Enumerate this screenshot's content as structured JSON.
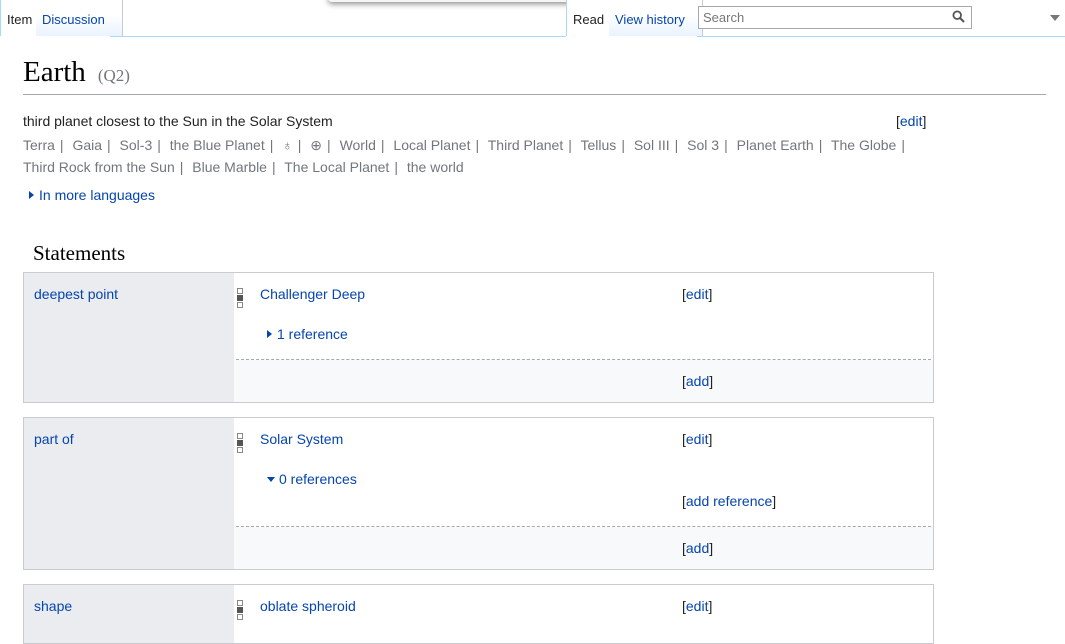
{
  "tabs": {
    "item": "Item",
    "discussion": "Discussion",
    "read": "Read",
    "view_history": "View history"
  },
  "search": {
    "placeholder": "Search"
  },
  "entity": {
    "label": "Earth",
    "id": "(Q2)",
    "description": "third planet closest to the Sun in the Solar System",
    "edit_label": "edit",
    "aliases": [
      "Terra",
      "Gaia",
      "Sol-3",
      "the Blue Planet",
      "♁",
      "⊕",
      "World",
      "Local Planet",
      "Third Planet",
      "Tellus",
      "Sol III",
      "Sol 3",
      "Planet Earth",
      "The Globe",
      "Third Rock from the Sun",
      "Blue Marble",
      "The Local Planet",
      "the world"
    ],
    "more_languages": "In more languages"
  },
  "statements": {
    "heading": "Statements",
    "groups": [
      {
        "property": "deepest point",
        "value": "Challenger Deep",
        "edit": "edit",
        "refs": "1 reference",
        "add": "add"
      },
      {
        "property": "part of",
        "value": "Solar System",
        "edit": "edit",
        "refs": "0 references",
        "add_reference": "add reference",
        "add": "add"
      },
      {
        "property": "shape",
        "value": "oblate spheroid",
        "edit": "edit"
      }
    ]
  },
  "colors": {
    "link": "#0645ad",
    "muted": "#72777d",
    "prop_bg": "#eaecf0",
    "tab_border": "#a7d7f9"
  }
}
